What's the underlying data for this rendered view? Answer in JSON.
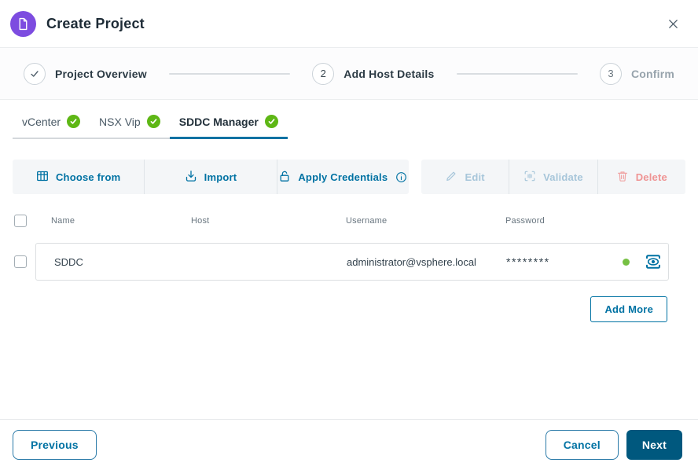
{
  "header": {
    "title": "Create Project"
  },
  "stepper": {
    "steps": [
      {
        "label": "Project Overview",
        "status": "complete"
      },
      {
        "number": "2",
        "label": "Add Host Details",
        "status": "current"
      },
      {
        "number": "3",
        "label": "Confirm",
        "status": "upcoming"
      }
    ]
  },
  "tabs": [
    {
      "label": "vCenter",
      "status": "complete",
      "active": false
    },
    {
      "label": "NSX Vip",
      "status": "complete",
      "active": false
    },
    {
      "label": "SDDC Manager",
      "status": "complete",
      "active": true
    }
  ],
  "toolbar": {
    "choose_from": "Choose from",
    "import": "Import",
    "apply_credentials": "Apply Credentials",
    "edit": "Edit",
    "validate": "Validate",
    "delete": "Delete"
  },
  "table": {
    "columns": [
      "Name",
      "Host",
      "Username",
      "Password"
    ],
    "rows": [
      {
        "name": "SDDC",
        "host": "",
        "host_redacted": true,
        "username": "administrator@vsphere.local",
        "password_masked": "********",
        "status_ok": true
      }
    ]
  },
  "add_more_label": "Add More",
  "footer": {
    "previous": "Previous",
    "cancel": "Cancel",
    "next": "Next"
  },
  "colors": {
    "accent_blue": "#0072a3",
    "primary_button": "#00587e",
    "success_green": "#5eb715",
    "status_dot_green": "#76c043",
    "danger_disabled": "#ef9494",
    "disabled_blue": "#a7c6da",
    "brand_purple": "#7d4ce0"
  }
}
